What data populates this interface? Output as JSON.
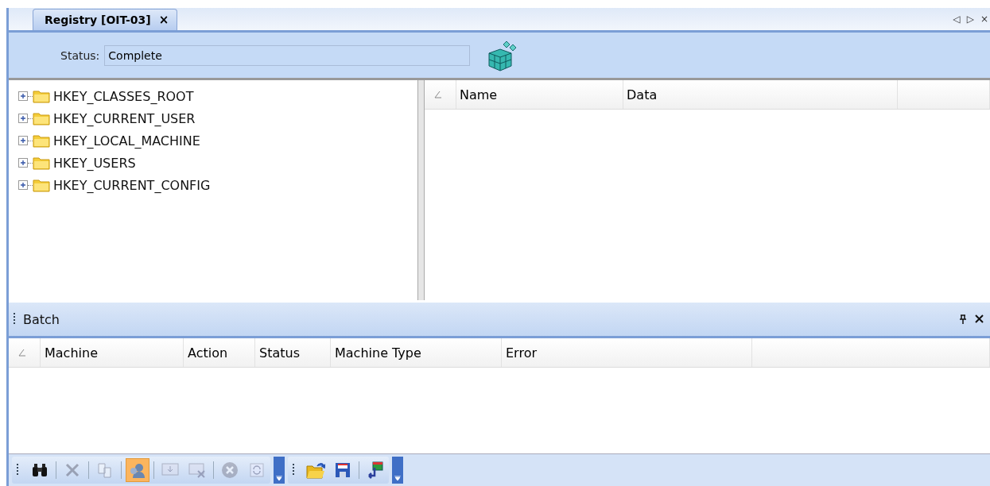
{
  "tab": {
    "label": "Registry [OIT-03]",
    "close": "×",
    "selected": true
  },
  "tab_strip_controls": [
    "◁",
    "▷",
    "×"
  ],
  "status": {
    "label": "Status:",
    "value": "Complete"
  },
  "tree": {
    "items": [
      {
        "label": "HKEY_CLASSES_ROOT",
        "expanded": false
      },
      {
        "label": "HKEY_CURRENT_USER",
        "expanded": false
      },
      {
        "label": "HKEY_LOCAL_MACHINE",
        "expanded": false
      },
      {
        "label": "HKEY_USERS",
        "expanded": false
      },
      {
        "label": "HKEY_CURRENT_CONFIG",
        "expanded": false
      }
    ]
  },
  "values_table": {
    "columns": [
      "Name",
      "Data"
    ]
  },
  "batch": {
    "title": "Batch",
    "columns": [
      "Machine",
      "Action",
      "Status",
      "Machine Type",
      "Error"
    ]
  },
  "toolbars": [
    {
      "buttons": [
        {
          "kind": "find",
          "selected": false,
          "disabled": false
        },
        {
          "kind": "separator"
        },
        {
          "kind": "delete",
          "selected": false,
          "disabled": true
        },
        {
          "kind": "separator"
        },
        {
          "kind": "copy",
          "selected": false,
          "disabled": true
        },
        {
          "kind": "separator"
        },
        {
          "kind": "user",
          "selected": true,
          "disabled": false
        },
        {
          "kind": "separator"
        },
        {
          "kind": "monitor",
          "selected": false,
          "disabled": true
        },
        {
          "kind": "monitor-x",
          "selected": false,
          "disabled": true
        },
        {
          "kind": "separator"
        },
        {
          "kind": "stop",
          "selected": false,
          "disabled": true
        },
        {
          "kind": "refresh",
          "selected": false,
          "disabled": true
        }
      ]
    },
    {
      "buttons": [
        {
          "kind": "open",
          "selected": false,
          "disabled": false
        },
        {
          "kind": "save",
          "selected": false,
          "disabled": false
        },
        {
          "kind": "separator"
        },
        {
          "kind": "export",
          "selected": false,
          "disabled": false
        }
      ]
    }
  ]
}
